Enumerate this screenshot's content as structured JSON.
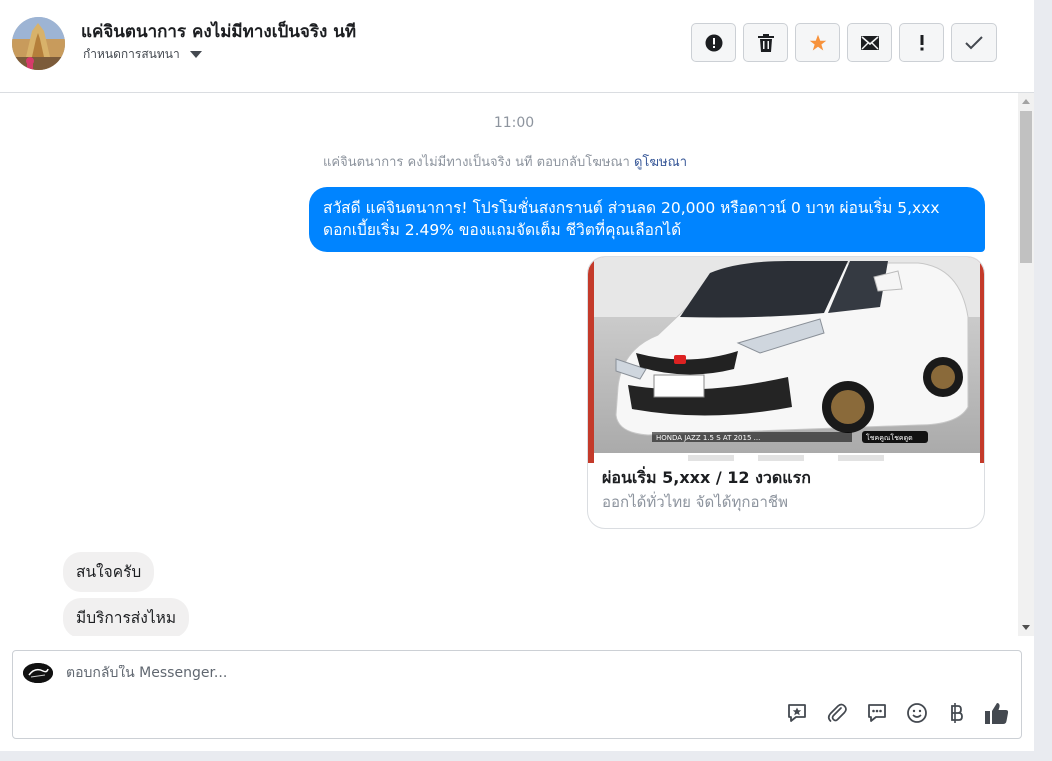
{
  "header": {
    "contact_name": "แค่จินตนาการ คงไม่มีทางเป็นจริง นที",
    "assign_label": "กำหนดการสนทนา",
    "actions": [
      "spam",
      "delete",
      "star",
      "mark-unread",
      "important",
      "done"
    ]
  },
  "conversation": {
    "time": "11:00",
    "ad_reply_text": "แค่จินตนาการ คงไม่มีทางเป็นจริง นที ตอบกลับโฆษณา",
    "ad_reply_link": "ดูโฆษณา",
    "outgoing_message": "สวัสดี แค่จินตนาการ! โปรโมชั่นสงกรานต์ ส่วนลด 20,000 หรือดาวน์ 0 บาท ผ่อนเริ่ม 5,xxx ดอกเบี้ยเริ่ม 2.49% ของแถมจัดเต็ม ชีวิตที่คุณเลือกได้",
    "ad_card": {
      "image_caption": "HONDA JAZZ 1.5 S AT 2015 ...",
      "image_tag": "โชคคูณโชคดูด",
      "title": "ผ่อนเริ่ม 5,xxx / 12 งวดแรก",
      "subtitle": "ออกได้ทั่วไทย จัดได้ทุกอาชีพ"
    },
    "incoming_messages": [
      "สนใจครับ",
      "มีบริการส่งไหม"
    ]
  },
  "composer": {
    "placeholder": "ตอบกลับใน Messenger...",
    "value": "",
    "tools": [
      "saved-reply-icon",
      "attachment-icon",
      "quick-reply-icon",
      "emoji-icon",
      "baht-icon",
      "thumbs-up-icon"
    ]
  },
  "colors": {
    "accent": "#0084ff",
    "star": "#f7923b",
    "incoming_bubble": "#f1f0f0"
  }
}
